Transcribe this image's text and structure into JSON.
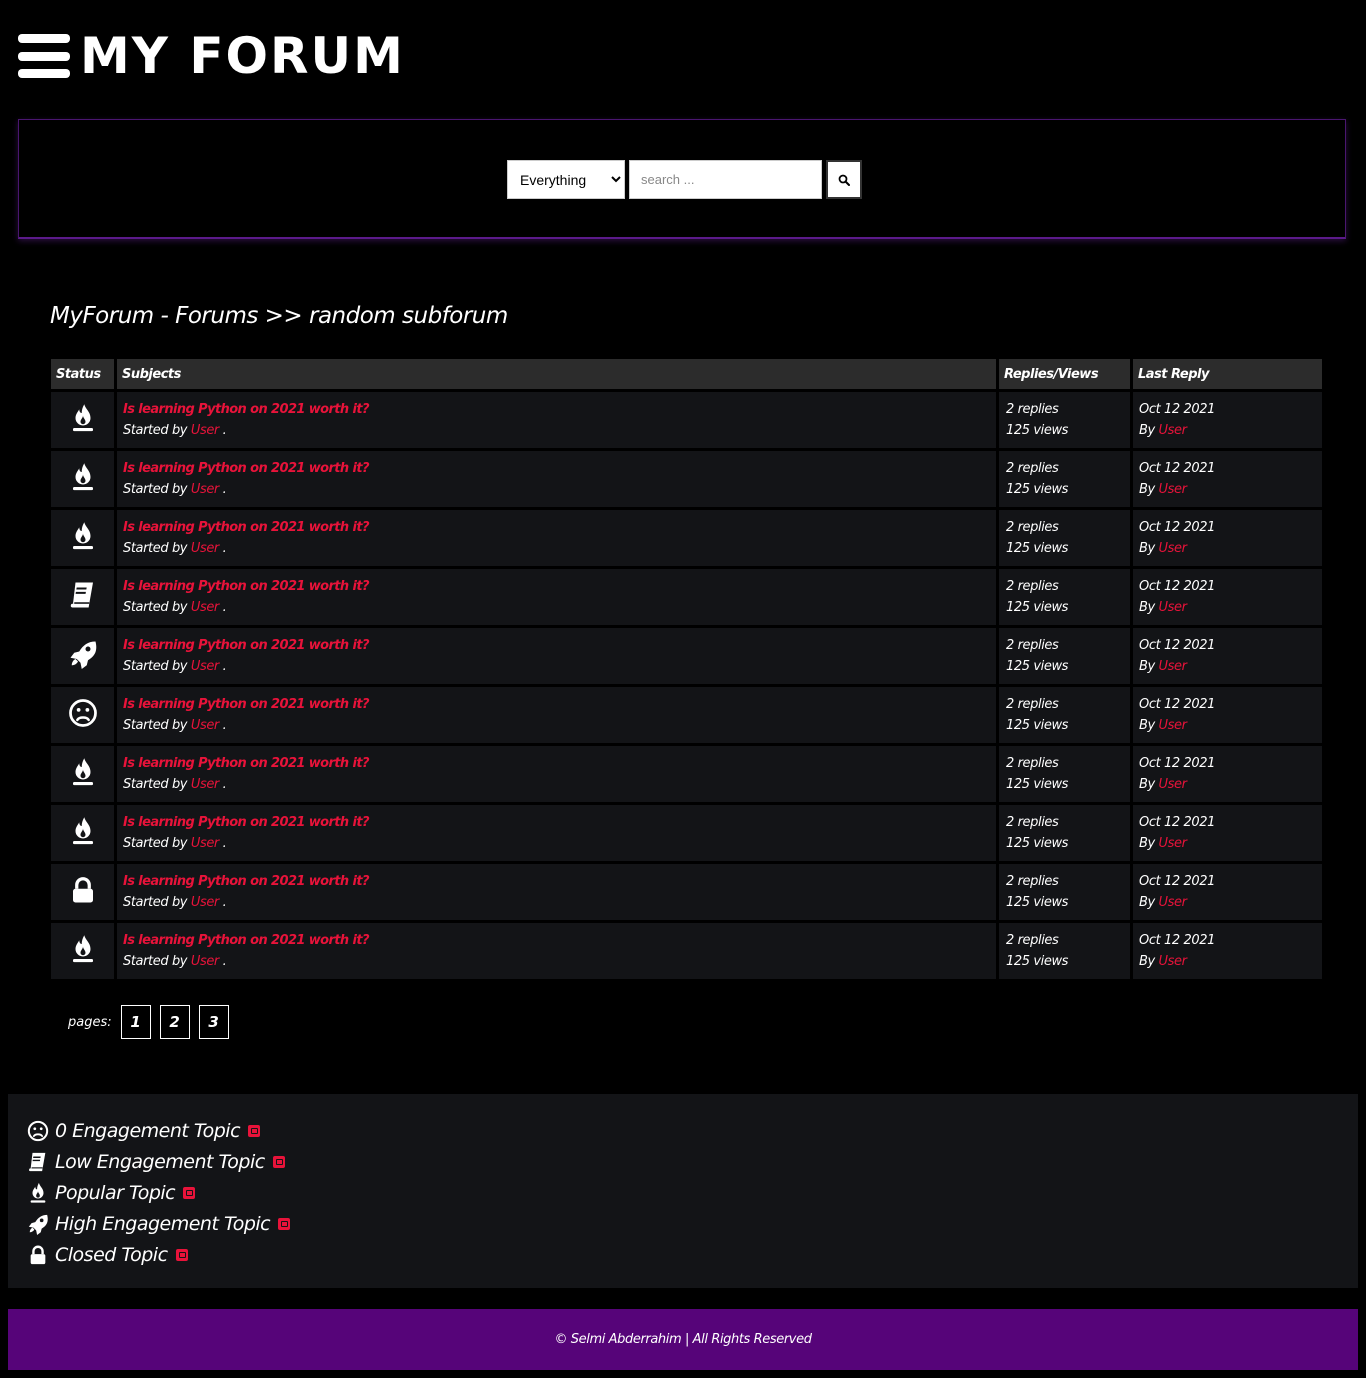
{
  "header": {
    "logo_text": "MY FORUM"
  },
  "search": {
    "scope_selected": "Everything",
    "placeholder": "search ..."
  },
  "breadcrumb": "MyForum - Forums >> random subforum",
  "table": {
    "headers": [
      "Status",
      "Subjects",
      "Replies/Views",
      "Last Reply"
    ],
    "rows": [
      {
        "status_icon": "fire-icon",
        "title": "Is learning Python on 2021 worth it?",
        "started_prefix": "Started by",
        "author": "User",
        "dot": ".",
        "replies": "2 replies",
        "views": "125 views",
        "date": "Oct 12 2021",
        "by_prefix": "By",
        "last_user": "User"
      },
      {
        "status_icon": "fire-icon",
        "title": "Is learning Python on 2021 worth it?",
        "started_prefix": "Started by",
        "author": "User",
        "dot": ".",
        "replies": "2 replies",
        "views": "125 views",
        "date": "Oct 12 2021",
        "by_prefix": "By",
        "last_user": "User"
      },
      {
        "status_icon": "fire-icon",
        "title": "Is learning Python on 2021 worth it?",
        "started_prefix": "Started by",
        "author": "User",
        "dot": ".",
        "replies": "2 replies",
        "views": "125 views",
        "date": "Oct 12 2021",
        "by_prefix": "By",
        "last_user": "User"
      },
      {
        "status_icon": "book-icon",
        "title": "Is learning Python on 2021 worth it?",
        "started_prefix": "Started by",
        "author": "User",
        "dot": ".",
        "replies": "2 replies",
        "views": "125 views",
        "date": "Oct 12 2021",
        "by_prefix": "By",
        "last_user": "User"
      },
      {
        "status_icon": "rocket-icon",
        "title": "Is learning Python on 2021 worth it?",
        "started_prefix": "Started by",
        "author": "User",
        "dot": ".",
        "replies": "2 replies",
        "views": "125 views",
        "date": "Oct 12 2021",
        "by_prefix": "By",
        "last_user": "User"
      },
      {
        "status_icon": "sad-face-icon",
        "title": "Is learning Python on 2021 worth it?",
        "started_prefix": "Started by",
        "author": "User",
        "dot": ".",
        "replies": "2 replies",
        "views": "125 views",
        "date": "Oct 12 2021",
        "by_prefix": "By",
        "last_user": "User"
      },
      {
        "status_icon": "fire-icon",
        "title": "Is learning Python on 2021 worth it?",
        "started_prefix": "Started by",
        "author": "User",
        "dot": ".",
        "replies": "2 replies",
        "views": "125 views",
        "date": "Oct 12 2021",
        "by_prefix": "By",
        "last_user": "User"
      },
      {
        "status_icon": "fire-icon",
        "title": "Is learning Python on 2021 worth it?",
        "started_prefix": "Started by",
        "author": "User",
        "dot": ".",
        "replies": "2 replies",
        "views": "125 views",
        "date": "Oct 12 2021",
        "by_prefix": "By",
        "last_user": "User"
      },
      {
        "status_icon": "lock-icon",
        "title": "Is learning Python on 2021 worth it?",
        "started_prefix": "Started by",
        "author": "User",
        "dot": ".",
        "replies": "2 replies",
        "views": "125 views",
        "date": "Oct 12 2021",
        "by_prefix": "By",
        "last_user": "User"
      },
      {
        "status_icon": "fire-icon",
        "title": "Is learning Python on 2021 worth it?",
        "started_prefix": "Started by",
        "author": "User",
        "dot": ".",
        "replies": "2 replies",
        "views": "125 views",
        "date": "Oct 12 2021",
        "by_prefix": "By",
        "last_user": "User"
      }
    ]
  },
  "pagination": {
    "label": "pages:",
    "pages": [
      "1",
      "2",
      "3"
    ]
  },
  "legend": {
    "items": [
      {
        "icon": "sad-face-icon",
        "label": "0 Engagement Topic"
      },
      {
        "icon": "book-icon",
        "label": "Low Engagement Topic"
      },
      {
        "icon": "fire-icon",
        "label": "Popular Topic"
      },
      {
        "icon": "rocket-icon",
        "label": "High Engagement Topic"
      },
      {
        "icon": "lock-icon",
        "label": "Closed Topic"
      }
    ]
  },
  "footer": {
    "text": "© Selmi Abderrahim | All Rights Reserved"
  },
  "colors": {
    "accent_red": "#e8133a",
    "footer_purple": "#560479",
    "row_bg": "#131417",
    "header_bg": "#2c2c2c"
  }
}
